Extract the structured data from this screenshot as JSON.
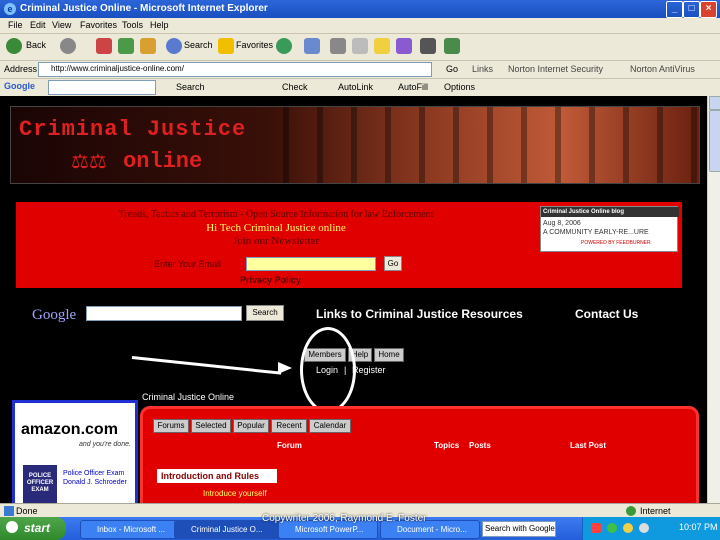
{
  "window": {
    "title": "Criminal Justice Online - Microsoft Internet Explorer"
  },
  "menu": [
    "File",
    "Edit",
    "View",
    "Favorites",
    "Tools",
    "Help"
  ],
  "toolbar": {
    "back": "Back",
    "search": "Search",
    "favorites": "Favorites"
  },
  "address": {
    "label": "Address",
    "url": "http://www.criminaljustice-online.com/",
    "go": "Go",
    "links": "Links",
    "norton_security": "Norton Internet Security",
    "norton_antivirus": "Norton AntiVirus"
  },
  "google_toolbar": {
    "logo": "Google",
    "search": "Search",
    "check": "Check",
    "autolink": "AutoLink",
    "autofill": "AutoFill",
    "options": "Options"
  },
  "site": {
    "logo_line1": "Criminal Justice",
    "logo_line2": "online",
    "tagline": "Trends, Tactics and Terrorism - Open Source Information for law Enforcement",
    "hitech": "Hi Tech Criminal Justice online",
    "join": "Join our Newsletter",
    "email_label": "Enter Your Email",
    "go": "Go",
    "privacy": "Privacy Policy",
    "blog_title": "Criminal Justice Online blog",
    "blog_date": "Aug 8, 2006",
    "blog_text": "A COMMUNITY EARLY-RE...URE",
    "blog_footer": "POWERED BY FEEDBURNER",
    "google_logo": "Google",
    "google_search": "Search",
    "links": "Links to Criminal Justice Resources",
    "contact": "Contact Us",
    "members": "Members",
    "help": "Help",
    "home": "Home",
    "login": "Login",
    "sep": "|",
    "register": "Register",
    "forum_section": "Criminal Justice Online",
    "amazon": "amazon.com",
    "amazon_tag": "and you're done.",
    "book_label": "POLICE OFFICER EXAM",
    "book_text": "Police Officer Exam Donald J. Schroeder",
    "forum_tabs": [
      "Forums",
      "Selected",
      "Popular",
      "Recent",
      "Calendar"
    ],
    "forum_cols": [
      "Forum",
      "Topics",
      "Posts",
      "Last Post"
    ],
    "intro": "Introduction and Rules",
    "intro_link": "Introduce yourself"
  },
  "status": {
    "done": "Done",
    "zone": "Internet"
  },
  "taskbar": {
    "start": "start",
    "tasks": [
      "Inbox - Microsoft ...",
      "Criminal Justice O...",
      "Microsoft PowerP...",
      "Document - Micro...",
      "Search with Google"
    ],
    "clock": "10:07 PM"
  },
  "caption": "Copywriter 2006, Raymond E. Foster",
  "colors": {
    "accent_red": "#e00000",
    "title_blue": "#245edb"
  }
}
